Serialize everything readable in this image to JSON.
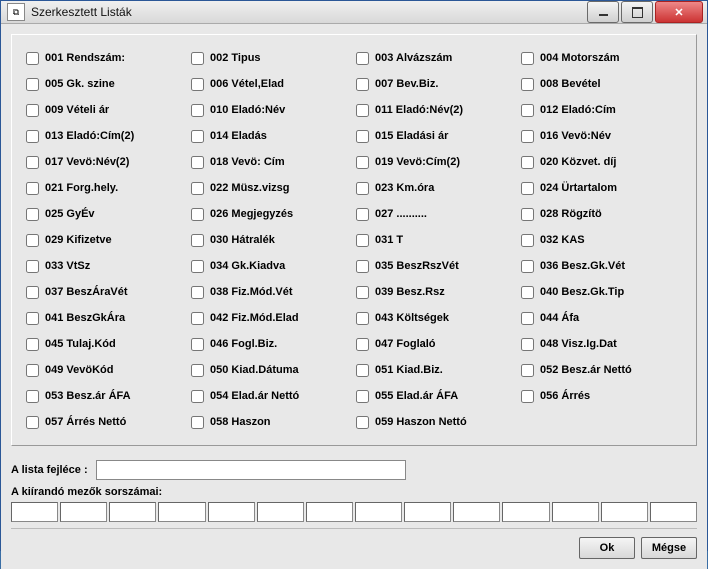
{
  "window": {
    "title": "Szerkesztett Listák"
  },
  "items": [
    {
      "label": "001 Rendszám:"
    },
    {
      "label": "002 Tipus"
    },
    {
      "label": "003 Alvázszám"
    },
    {
      "label": "004 Motorszám"
    },
    {
      "label": "005 Gk. szine"
    },
    {
      "label": "006 Vétel,Elad"
    },
    {
      "label": "007 Bev.Biz."
    },
    {
      "label": "008 Bevétel"
    },
    {
      "label": "009 Vételi ár"
    },
    {
      "label": "010 Eladó:Név"
    },
    {
      "label": "011 Eladó:Név(2)"
    },
    {
      "label": "012 Eladó:Cím"
    },
    {
      "label": "013 Eladó:Cím(2)"
    },
    {
      "label": "014 Eladás"
    },
    {
      "label": "015 Eladási ár"
    },
    {
      "label": "016 Vevö:Név"
    },
    {
      "label": "017 Vevö:Név(2)"
    },
    {
      "label": "018 Vevö: Cím"
    },
    {
      "label": "019 Vevö:Cím(2)"
    },
    {
      "label": "020 Közvet. díj"
    },
    {
      "label": "021 Forg.hely."
    },
    {
      "label": "022 Müsz.vizsg"
    },
    {
      "label": "023 Km.óra"
    },
    {
      "label": "024 Ürtartalom"
    },
    {
      "label": "025 GyÉv"
    },
    {
      "label": "026 Megjegyzés"
    },
    {
      "label": "027 .........."
    },
    {
      "label": "028 Rögzítö"
    },
    {
      "label": "029 Kifizetve"
    },
    {
      "label": "030 Hátralék"
    },
    {
      "label": "031 T"
    },
    {
      "label": "032 KAS"
    },
    {
      "label": "033 VtSz"
    },
    {
      "label": "034 Gk.Kiadva"
    },
    {
      "label": "035 BeszRszVét"
    },
    {
      "label": "036 Besz.Gk.Vét"
    },
    {
      "label": "037 BeszÁraVét"
    },
    {
      "label": "038 Fiz.Mód.Vét"
    },
    {
      "label": "039 Besz.Rsz"
    },
    {
      "label": "040 Besz.Gk.Tip"
    },
    {
      "label": "041 BeszGkÁra"
    },
    {
      "label": "042 Fiz.Mód.Elad"
    },
    {
      "label": "043 Költségek"
    },
    {
      "label": "044 Áfa"
    },
    {
      "label": "045 Tulaj.Kód"
    },
    {
      "label": "046 Fogl.Biz."
    },
    {
      "label": "047 Foglaló"
    },
    {
      "label": "048 Visz.Ig.Dat"
    },
    {
      "label": "049 VevöKód"
    },
    {
      "label": "050 Kiad.Dátuma"
    },
    {
      "label": "051 Kiad.Biz."
    },
    {
      "label": "052 Besz.ár Nettó"
    },
    {
      "label": "053 Besz.ár ÁFA"
    },
    {
      "label": "054 Elad.ár Nettó"
    },
    {
      "label": "055 Elad.ár ÁFA"
    },
    {
      "label": "056 Árrés"
    },
    {
      "label": "057 Árrés Nettó"
    },
    {
      "label": "058 Haszon"
    },
    {
      "label": "059 Haszon Nettó"
    },
    {
      "label": ""
    }
  ],
  "form": {
    "header_label": "A lista fejléce :",
    "header_value": "",
    "fields_label": "A kiírandó mezők sorszámai:",
    "field_values": [
      "",
      "",
      "",
      "",
      "",
      "",
      "",
      "",
      "",
      "",
      "",
      "",
      "",
      ""
    ]
  },
  "buttons": {
    "ok": "Ok",
    "cancel": "Mégse"
  }
}
